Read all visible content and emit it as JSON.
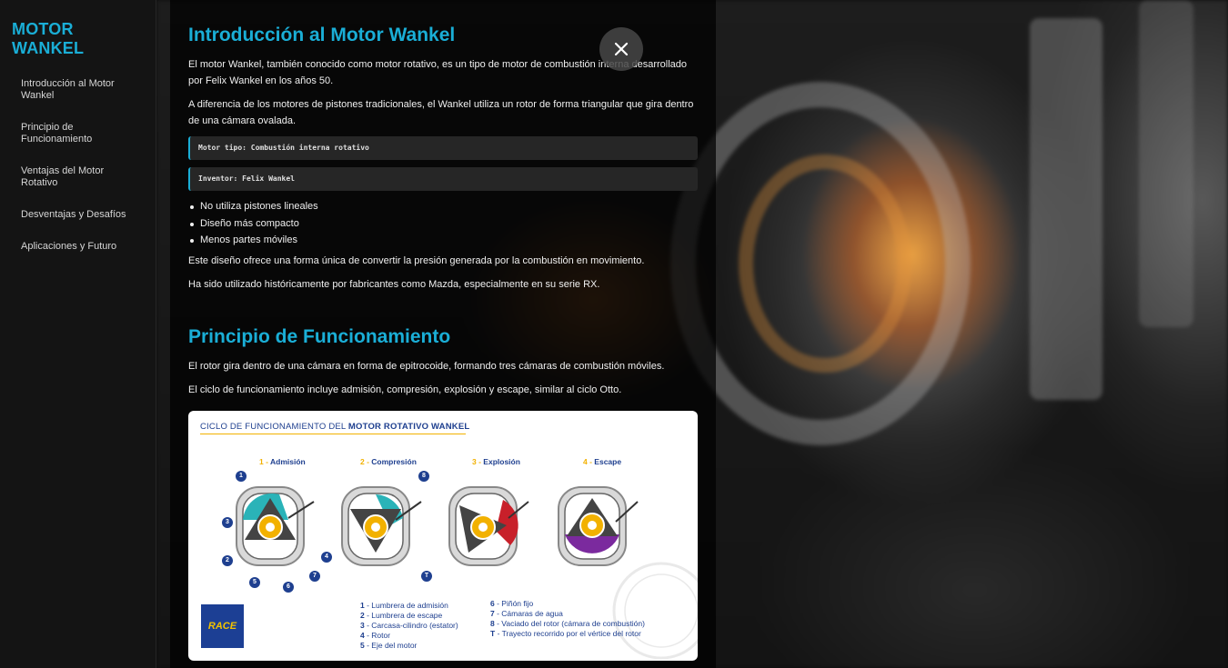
{
  "sidebar": {
    "logo": "MOTOR\nWANKEL",
    "logo_line1": "MOTOR",
    "logo_line2": "WANKEL",
    "items": [
      {
        "label": "Introducción al Motor Wankel"
      },
      {
        "label": "Principio de Funcionamiento"
      },
      {
        "label": "Ventajas del Motor Rotativo"
      },
      {
        "label": "Desventajas y Desafíos"
      },
      {
        "label": "Aplicaciones y Futuro"
      }
    ]
  },
  "close_icon": "close-icon",
  "intro": {
    "title": "Introducción al Motor Wankel",
    "p1": "El motor Wankel, también conocido como motor rotativo, es un tipo de motor de combustión interna desarrollado por Felix Wankel en los años 50.",
    "p2": "A diferencia de los motores de pistones tradicionales, el Wankel utiliza un rotor de forma triangular que gira dentro de una cámara ovalada.",
    "code1": "Motor tipo: Combustión interna rotativo",
    "code2": "Inventor: Felix Wankel",
    "bullets": [
      "No utiliza pistones lineales",
      "Diseño más compacto",
      "Menos partes móviles"
    ],
    "p3": "Este diseño ofrece una forma única de convertir la presión generada por la combustión en movimiento.",
    "p4": "Ha sido utilizado históricamente por fabricantes como Mazda, especialmente en su serie RX."
  },
  "principle": {
    "title": "Principio de Funcionamiento",
    "p1": "El rotor gira dentro de una cámara en forma de epitrocoide, formando tres cámaras de combustión móviles.",
    "p2": "El ciclo de funcionamiento incluye admisión, compresión, explosión y escape, similar al ciclo Otto."
  },
  "figure": {
    "title_prefix": "CICLO DE FUNCIONAMIENTO DEL ",
    "title_bold": "MOTOR ROTATIVO WANKEL",
    "stages": [
      {
        "num": "1",
        "label": "Admisión",
        "color": "#2ab3b8"
      },
      {
        "num": "2",
        "label": "Compresión",
        "color": "#2ab3b8"
      },
      {
        "num": "3",
        "label": "Explosión",
        "color": "#c8202a"
      },
      {
        "num": "4",
        "label": "Escape",
        "color": "#7b2a9e"
      }
    ],
    "legend_left": [
      {
        "n": "1",
        "t": "Lumbrera de admisión"
      },
      {
        "n": "2",
        "t": "Lumbrera de escape"
      },
      {
        "n": "3",
        "t": "Carcasa-cilindro (estator)"
      },
      {
        "n": "4",
        "t": "Rotor"
      },
      {
        "n": "5",
        "t": "Eje del motor"
      }
    ],
    "legend_right": [
      {
        "n": "6",
        "t": "Piñón fijo"
      },
      {
        "n": "7",
        "t": "Cámaras de agua"
      },
      {
        "n": "8",
        "t": "Vaciado del rotor (cámara de combustión)"
      },
      {
        "n": "T",
        "t": "Trayecto recorrido por el vértice del rotor"
      }
    ],
    "logo_text": "RACE",
    "badges": [
      "1",
      "3",
      "2",
      "5",
      "6",
      "7",
      "4",
      "8",
      "T"
    ]
  }
}
